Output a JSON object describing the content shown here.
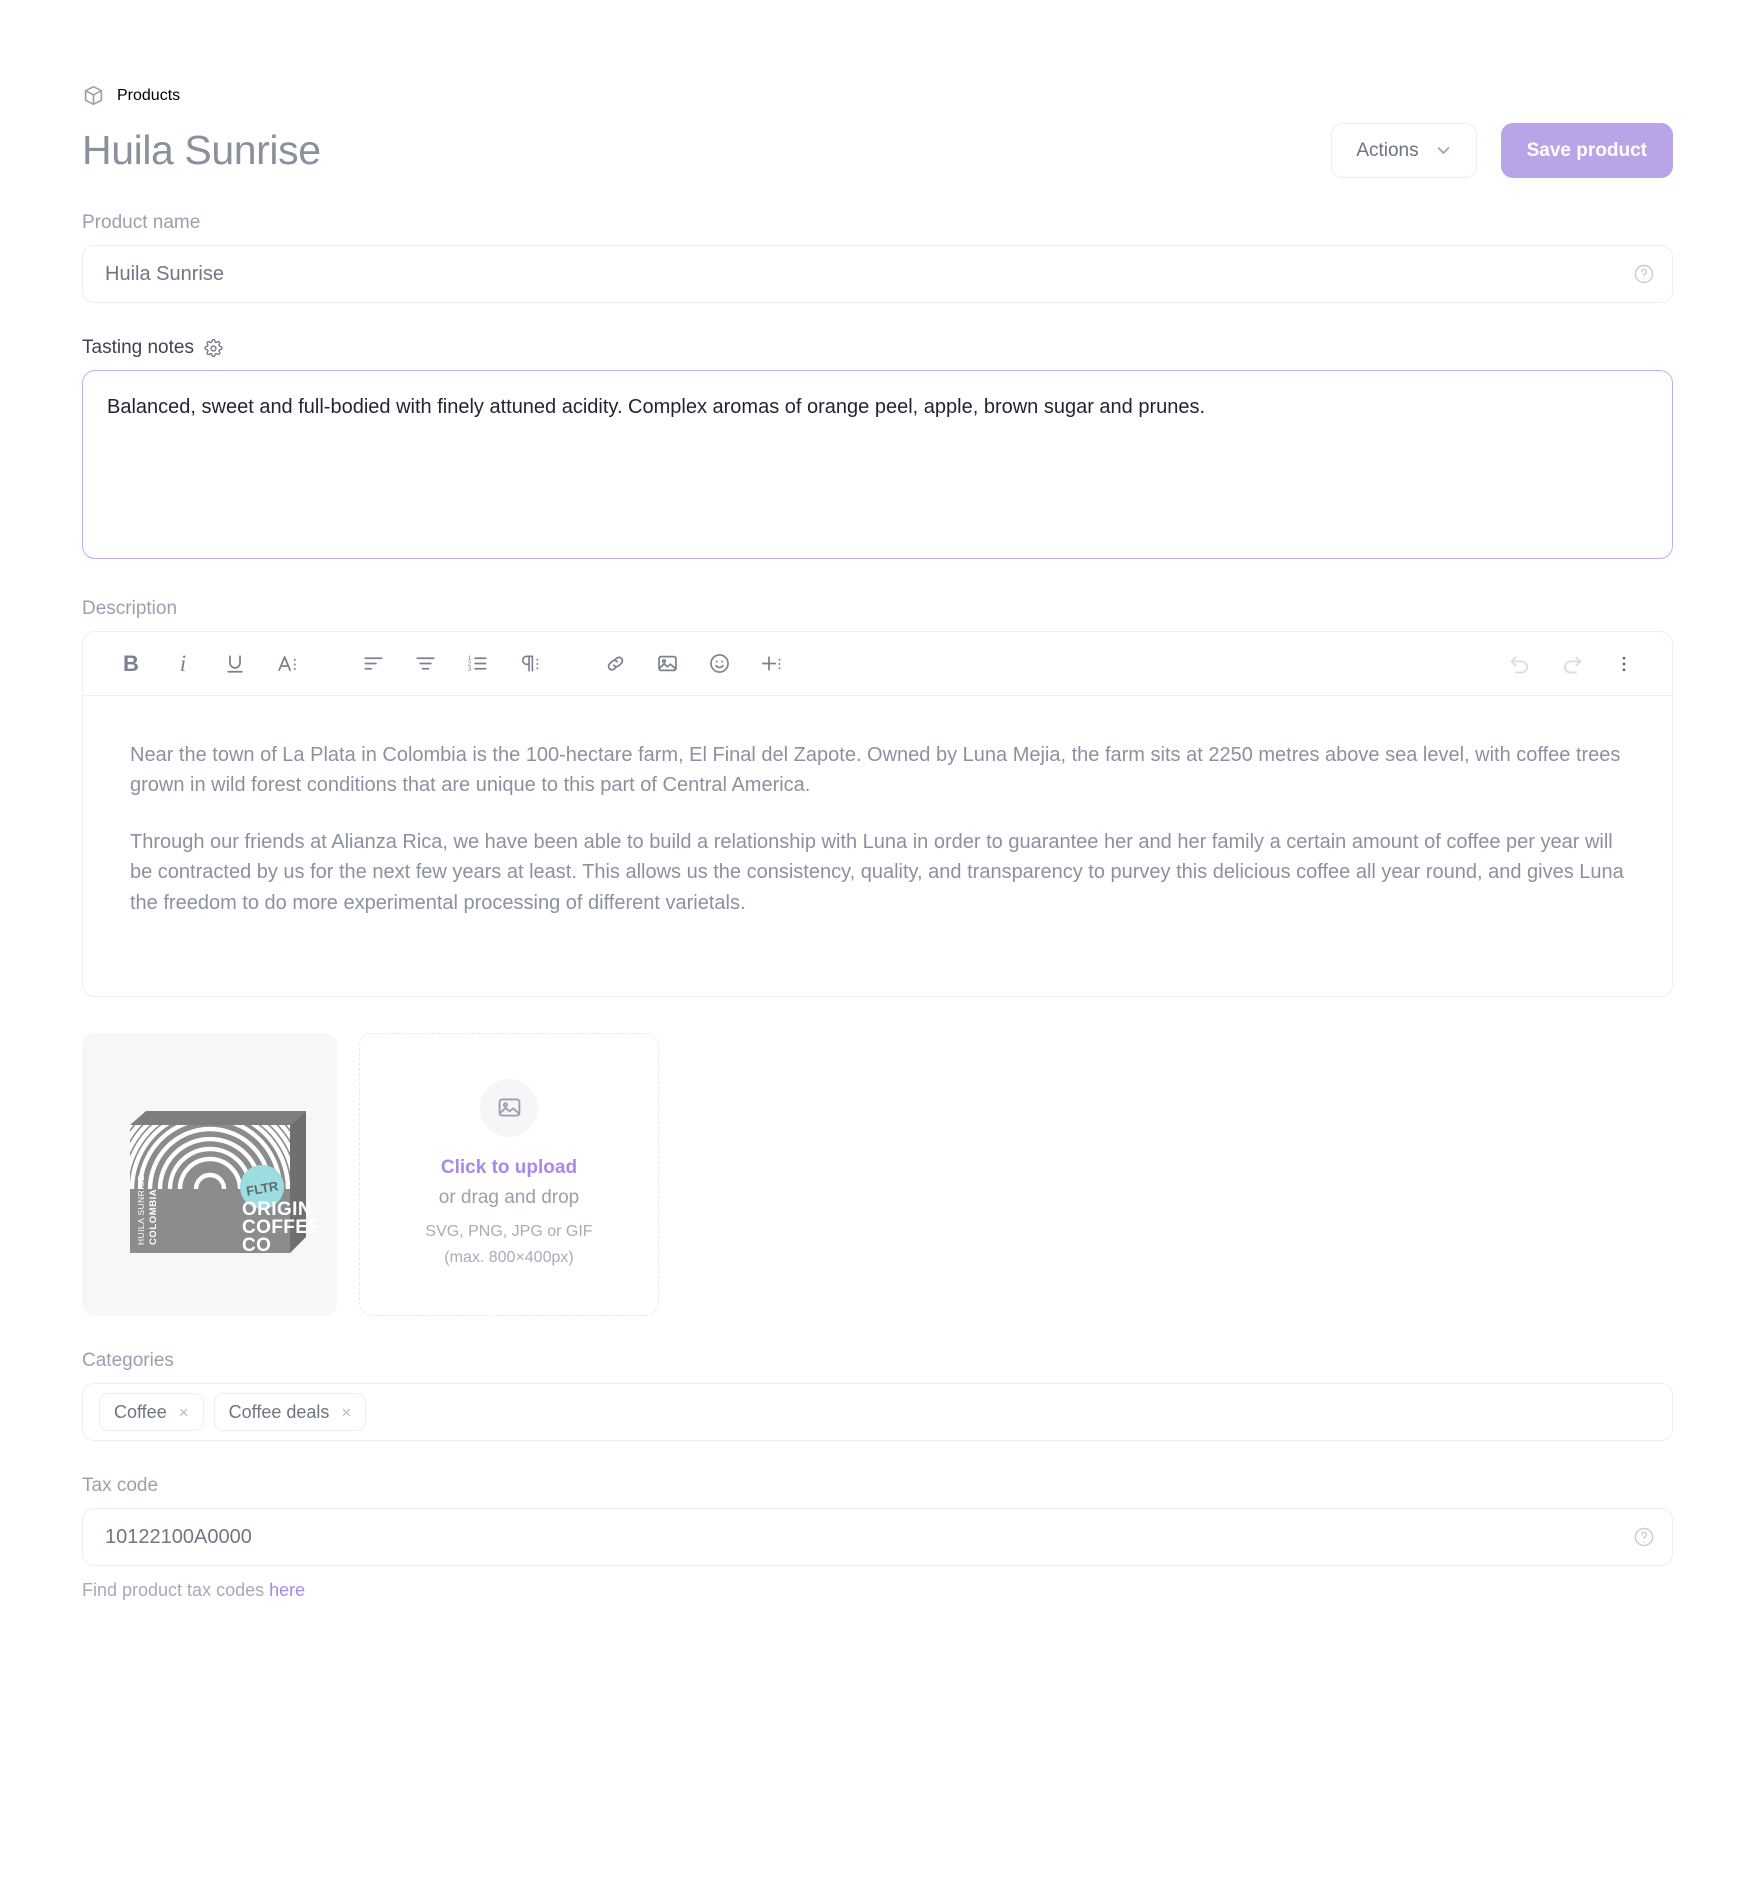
{
  "header": {
    "breadcrumb": "Products",
    "breadcrumb_icon": "cube-icon",
    "title": "Huila Sunrise",
    "actions_button": "Actions",
    "save_button": "Save product",
    "accent_color": "#b9a4e8"
  },
  "product_name": {
    "label": "Product name",
    "value": "Huila Sunrise",
    "help_icon": "help-circle-icon"
  },
  "tasting_notes": {
    "label": "Tasting notes",
    "settings_icon": "gear-icon",
    "value": "Balanced, sweet and full-bodied with finely attuned acidity. Complex aromas of orange peel, apple, brown sugar and prunes.",
    "focus_border_color": "#c5aef0"
  },
  "description": {
    "label": "Description",
    "toolbar": [
      {
        "name": "bold-icon",
        "glyph": "B"
      },
      {
        "name": "italic-icon",
        "glyph": "i"
      },
      {
        "name": "underline-icon",
        "glyph": "U"
      },
      {
        "name": "text-style-icon",
        "glyph": "A"
      },
      {
        "name": "align-left-icon",
        "glyph": ""
      },
      {
        "name": "align-center-icon",
        "glyph": ""
      },
      {
        "name": "numbered-list-icon",
        "glyph": ""
      },
      {
        "name": "paragraph-format-icon",
        "glyph": "¶"
      },
      {
        "name": "link-icon",
        "glyph": ""
      },
      {
        "name": "image-icon",
        "glyph": ""
      },
      {
        "name": "emoji-icon",
        "glyph": ""
      },
      {
        "name": "insert-more-icon",
        "glyph": "+"
      },
      {
        "name": "undo-icon",
        "glyph": ""
      },
      {
        "name": "redo-icon",
        "glyph": ""
      },
      {
        "name": "overflow-menu-icon",
        "glyph": ""
      }
    ],
    "paragraphs": [
      "Near the town of La Plata in Colombia is the 100-hectare farm, El Final del Zapote. Owned by Luna Mejia, the farm sits at 2250 metres above sea level, with coffee trees grown in wild forest conditions that are unique to this part of Central America.",
      "Through our friends at Alianza Rica, we have been able to build a relationship with Luna in order to guarantee her and her family a certain amount of coffee per year will be contracted by us for the next few years at least. This allows us the consistency, quality, and transparency to purvey this delicious coffee all year round, and gives Luna the freedom to do more experimental processing of different varietals."
    ]
  },
  "media": {
    "thumbnail": {
      "name": "product-image-thumbnail",
      "package_brand_line1": "ORIGIN",
      "package_brand_line2": "COFFEE",
      "package_brand_line3": "CO",
      "package_badge": "FLTR",
      "package_side_line1": "HUILA SUNRISE",
      "package_side_line2": "COLOMBIA",
      "badge_color": "#9ddde0",
      "box_color": "#8c8c8c"
    },
    "upload": {
      "icon": "image-placeholder-icon",
      "link_text": "Click to upload",
      "sub_text": "or drag and drop",
      "formats": "SVG, PNG, JPG or GIF",
      "max_size": "(max. 800×400px)"
    }
  },
  "categories": {
    "label": "Categories",
    "chips": [
      {
        "label": "Coffee",
        "remove": "×"
      },
      {
        "label": "Coffee deals",
        "remove": "×"
      }
    ]
  },
  "tax_code": {
    "label": "Tax code",
    "value": "10122100A0000",
    "help_icon": "help-circle-icon",
    "helper_prefix": "Find product tax codes ",
    "helper_link": "here"
  }
}
